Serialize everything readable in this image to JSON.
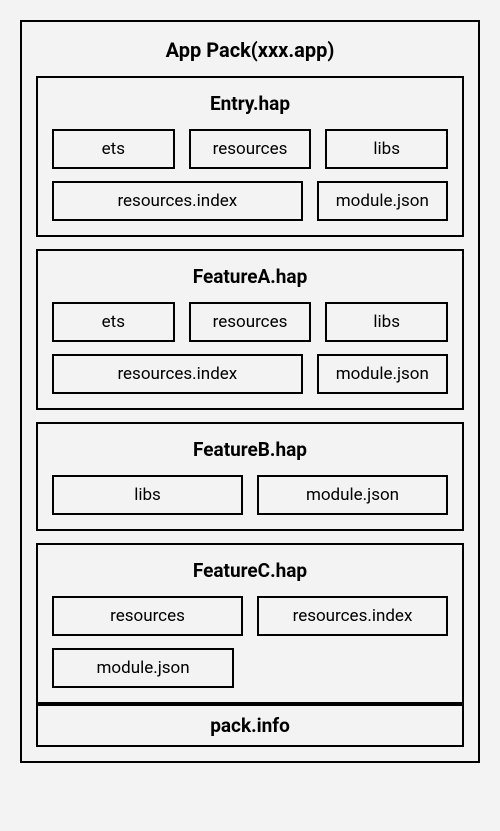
{
  "pack_title": "App Pack(xxx.app)",
  "modules": [
    {
      "title": "Entry.hap",
      "rows": [
        [
          {
            "label": "ets",
            "w": 1
          },
          {
            "label": "resources",
            "w": 1
          },
          {
            "label": "libs",
            "w": 1
          }
        ],
        [
          {
            "label": "resources.index",
            "w": 2
          },
          {
            "label": "module.json",
            "w": 1
          }
        ]
      ]
    },
    {
      "title": "FeatureA.hap",
      "rows": [
        [
          {
            "label": "ets",
            "w": 1
          },
          {
            "label": "resources",
            "w": 1
          },
          {
            "label": "libs",
            "w": 1
          }
        ],
        [
          {
            "label": "resources.index",
            "w": 2
          },
          {
            "label": "module.json",
            "w": 1
          }
        ]
      ]
    },
    {
      "title": "FeatureB.hap",
      "rows": [
        [
          {
            "label": "libs",
            "w": 1
          },
          {
            "label": "module.json",
            "w": 1
          }
        ]
      ]
    },
    {
      "title": "FeatureC.hap",
      "rows": [
        [
          {
            "label": "resources",
            "w": 1
          },
          {
            "label": "resources.index",
            "w": 1
          }
        ],
        [
          {
            "label": "module.json",
            "w": 1,
            "narrow": true
          }
        ]
      ]
    }
  ],
  "pack_info": "pack.info"
}
